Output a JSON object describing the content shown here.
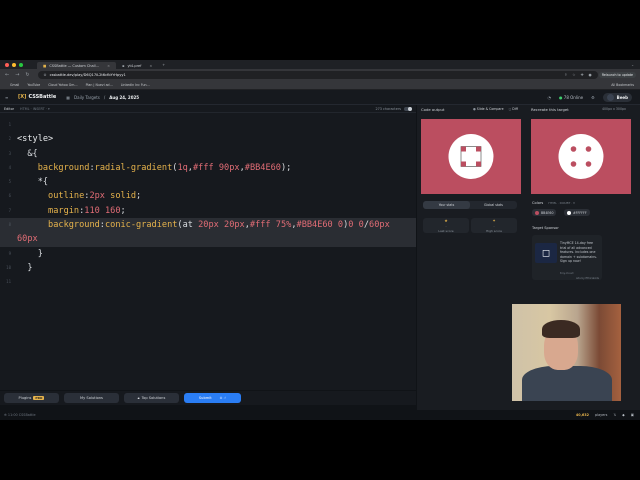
{
  "browser": {
    "tabs": [
      {
        "label": "CSSBattle — Custom Chall…",
        "active": true
      },
      {
        "label": "yt4-pref",
        "active": false
      }
    ],
    "right_label": "⌄",
    "url": "cssbattle.dev/play/D6Q17iL2t6cfbYrHpyy1",
    "relaunch": "Relaunch to update",
    "bookmarks": [
      "Gmail",
      "YouTube",
      "Cloud Yahoo Gm…",
      "Plan | Nuevi ad…",
      "LinkedIn Inc Fun…"
    ],
    "all_bookmarks": "All Bookmarks"
  },
  "header": {
    "logo": "CSSBattle",
    "crumbs": [
      "Daily Targets",
      "Aug 24, 2025"
    ],
    "online": "78 Online",
    "user": "Beeb"
  },
  "editor": {
    "label": "Editor",
    "sub": "HTML · INSERT · ▾",
    "chars": "273 characters",
    "lines": [
      {
        "n": "1",
        "html": ""
      },
      {
        "n": "2",
        "html": "<span class='tok-tag'>&lt;style&gt;</span>"
      },
      {
        "n": "3",
        "html": "  <span class='tok-plain'>&amp;{</span>"
      },
      {
        "n": "4",
        "html": "    <span class='tok-prop'>background</span>:<span class='tok-fn'>radial-gradient</span>(<span class='tok-num'>1q</span>,<span class='tok-num'>#fff</span> <span class='tok-num'>90px</span>,<span class='tok-num'>#BB4E60</span>);"
      },
      {
        "n": "5",
        "html": "    <span class='tok-plain'>*{</span>"
      },
      {
        "n": "6",
        "html": "      <span class='tok-prop'>outline</span>:<span class='tok-num'>2px</span> <span class='tok-val'>solid</span>;"
      },
      {
        "n": "7",
        "html": "      <span class='tok-prop'>margin</span>:<span class='tok-num'>110</span> <span class='tok-num'>160</span>;"
      },
      {
        "n": "8",
        "html": "      <span class='tok-prop'>background</span>:<span class='tok-fn'>conic-gradient</span>(at <span class='tok-num'>20px</span> <span class='tok-num'>20px</span>,<span class='tok-num'>#fff</span> <span class='tok-num'>75%</span>,<span class='tok-num'>#BB4E60</span> <span class='tok-num'>0</span>)<span class='tok-num'>0</span> <span class='tok-num'>0</span>/<span class='tok-num'>60px</span>",
        "hl": true
      },
      {
        "n": "",
        "html": "<span class='tok-num'>60px</span>",
        "cont": true
      },
      {
        "n": "9",
        "html": "    <span class='tok-plain'>}</span>"
      },
      {
        "n": "10",
        "html": "  <span class='tok-plain'>}</span>"
      },
      {
        "n": "11",
        "html": ""
      }
    ]
  },
  "toolbar": {
    "plugins": "Plugins",
    "pro": "PRO",
    "my_solutions": "My Solutions",
    "top_solutions": "Top Solutions",
    "submit": "Submit",
    "submit_kbd": "⌘ ⏎"
  },
  "status": {
    "left": "⊕ 11:00 CSSBattle",
    "players": "40,632",
    "players_suffix": "players"
  },
  "panel": {
    "output_label": "Code output",
    "slide_compare": "Slide & Compare",
    "diff": "Diff",
    "target_label": "Recreate this target",
    "target_size": "400px x 300px",
    "tab_your_stats": "Your stats",
    "tab_global": "Global stats",
    "stat1": "Last score",
    "stat2": "High score",
    "colors_title": "Colors",
    "colors_sub": "HTML · DOUBT · ▾",
    "colors": [
      {
        "hex": "#BB4E60",
        "label": "BB4E60"
      },
      {
        "hex": "#FFFFFF",
        "label": "#FFFFFF"
      }
    ],
    "sponsor_title": "Target Sponsor",
    "sponsor_text": "TinyMCE 14-day free trial of all advanced features. Includes one domain + subdomains. Sign up now!",
    "sponsor_foot": "tiny.cloud",
    "sponsor_ads": "Ads by EthicalAds"
  },
  "colors": {
    "accent": "#BB4E60",
    "submit": "#2A7DF4",
    "bg": "#16191E"
  }
}
